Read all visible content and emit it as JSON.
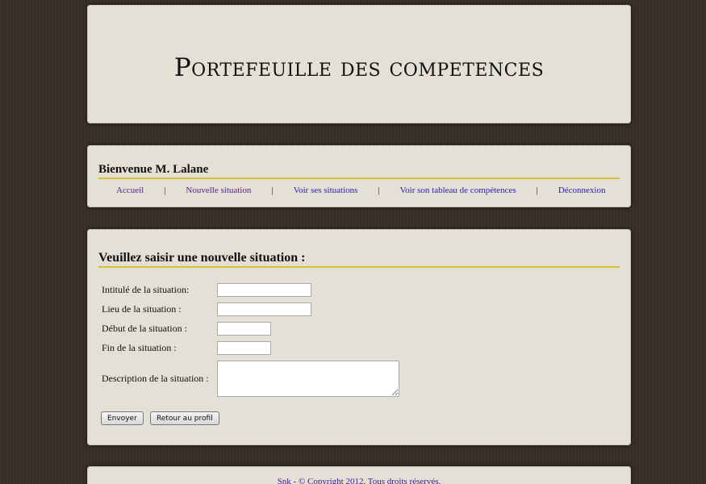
{
  "header": {
    "title": "Portefeuille des competences"
  },
  "nav": {
    "welcome": "Bienvenue M. Lalane",
    "items": [
      {
        "label": "Accueil"
      },
      {
        "label": "Nouvelle situation"
      },
      {
        "label": "Voir ses situations"
      },
      {
        "label": "Voir son tableau de compétences"
      },
      {
        "label": "Déconnexion"
      }
    ],
    "separator": "|"
  },
  "form": {
    "title": "Veuillez saisir une nouvelle situation :",
    "fields": {
      "intitule": {
        "label": "Intitulé de la situation:",
        "value": ""
      },
      "lieu": {
        "label": "Lieu de la situation :",
        "value": ""
      },
      "debut": {
        "label": "Début de la situation :",
        "value": ""
      },
      "fin": {
        "label": "Fin de la situation :",
        "value": ""
      },
      "description": {
        "label": "Description de la situation :",
        "value": ""
      }
    },
    "submit_label": "Envoyer",
    "back_label": "Retour au profil"
  },
  "footer": {
    "text": "Snk - © Copyright 2012. Tous droits réservés."
  }
}
